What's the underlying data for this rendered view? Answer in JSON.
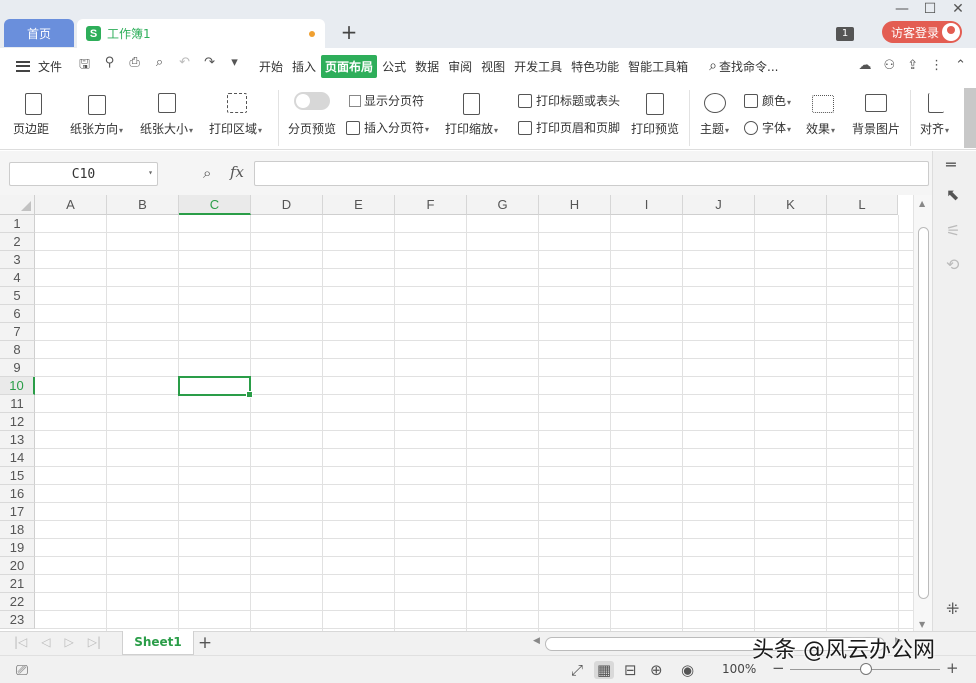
{
  "titlebar": {
    "home_tab": "首页",
    "doc_tab": "工作簿1",
    "doc_logo": "S",
    "badge": "1",
    "login": "访客登录",
    "controls": [
      "—",
      "☐",
      "✕"
    ]
  },
  "menu": {
    "file": "文件",
    "tabs": [
      "开始",
      "插入",
      "页面布局",
      "公式",
      "数据",
      "审阅",
      "视图",
      "开发工具",
      "特色功能",
      "智能工具箱"
    ],
    "active_tab": "页面布局",
    "search": "查找命令..."
  },
  "ribbon": {
    "margins": "页边距",
    "orientation": "纸张方向",
    "size": "纸张大小",
    "print_area": "打印区域",
    "page_break_preview": "分页预览",
    "show_page_breaks": "显示分页符",
    "insert_page_break": "插入分页符",
    "print_scaling": "打印缩放",
    "print_titles": "打印标题或表头",
    "header_footer": "打印页眉和页脚",
    "print_preview": "打印预览",
    "theme": "主题",
    "colors": "颜色",
    "fonts": "字体",
    "effects": "效果",
    "background": "背景图片",
    "align": "对齐"
  },
  "formula": {
    "cell_ref": "C10",
    "fx": "fx",
    "value": ""
  },
  "grid": {
    "columns": [
      "A",
      "B",
      "C",
      "D",
      "E",
      "F",
      "G",
      "H",
      "I",
      "J",
      "K",
      "L"
    ],
    "rows": [
      "1",
      "2",
      "3",
      "4",
      "5",
      "6",
      "7",
      "8",
      "9",
      "10",
      "11",
      "12",
      "13",
      "14",
      "15",
      "16",
      "17",
      "18",
      "19",
      "20",
      "21",
      "22",
      "23"
    ],
    "selected_col": "C",
    "selected_row": "10"
  },
  "sheets": {
    "tabs": [
      "Sheet1"
    ],
    "add": "+"
  },
  "status": {
    "zoom": "100%"
  },
  "watermark": "头条 @风云办公网",
  "colors": {
    "accent": "#2eae5a",
    "home_tab": "#6a8fdc",
    "login": "#e35d52"
  }
}
